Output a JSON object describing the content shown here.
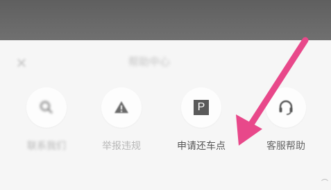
{
  "header": {
    "close_icon": "close-icon",
    "title": "帮助中心"
  },
  "actions": [
    {
      "icon": "search-icon",
      "label": "联系我们"
    },
    {
      "icon": "warning-icon",
      "label": "举报违规"
    },
    {
      "icon": "parking-icon",
      "icon_text": "P",
      "label": "申请还车点"
    },
    {
      "icon": "headset-icon",
      "label": "客服帮助"
    }
  ],
  "annotation": {
    "arrow_color": "#e8488a",
    "points_to": "申请还车点"
  },
  "colors": {
    "status_bar": "#666666",
    "page_background": "#f6f6f6",
    "icon_dark": "#5a5a5a",
    "muted_text": "#b8b8b8"
  }
}
